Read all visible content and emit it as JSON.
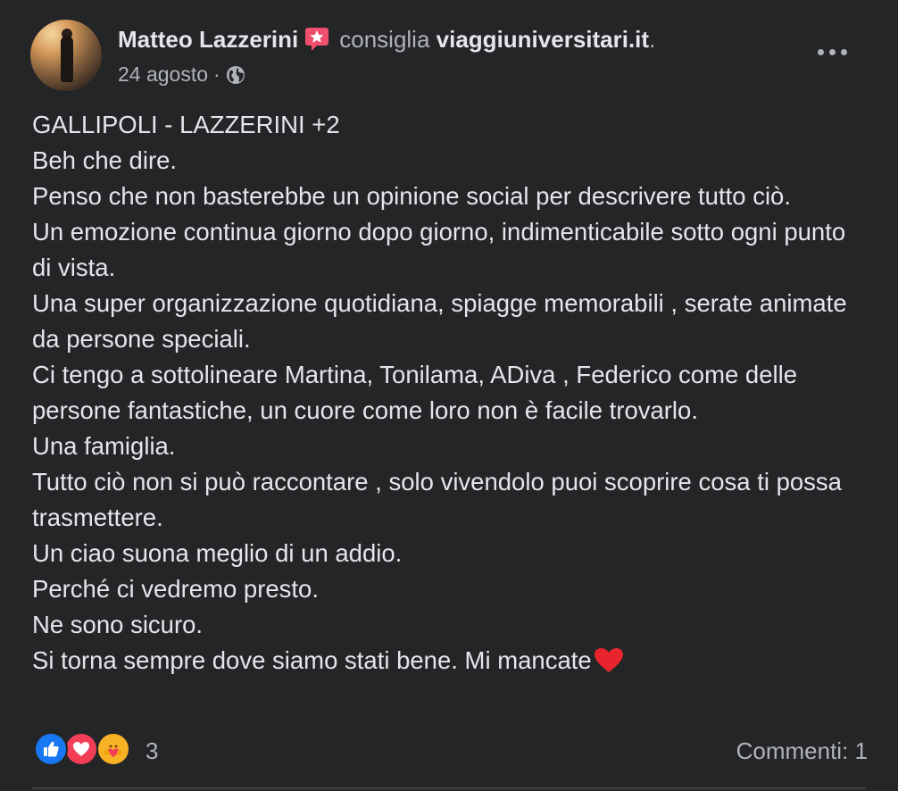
{
  "post": {
    "author": "Matteo Lazzerini",
    "action": "consiglia",
    "page": "viaggiuniversitari.it",
    "page_suffix": ".",
    "date": "24 agosto",
    "privacy_icon": "globe-icon",
    "badge_icon": "recommendation-star-icon",
    "more_icon": "more-options-icon",
    "paragraphs": [
      "GALLIPOLI - LAZZERINI +2",
      "Beh che dire.",
      "Penso che non basterebbe un opinione social per descrivere tutto ciò.",
      "Un emozione continua giorno dopo giorno, indimenticabile sotto ogni punto di vista.",
      "Una super organizzazione quotidiana, spiagge memorabili , serate animate da persone speciali.",
      "Ci tengo a sottolineare Martina, Tonilama, ADiva , Federico come delle persone fantastiche, un cuore come loro non è facile trovarlo.",
      "Una famiglia.",
      "Tutto ciò non si può raccontare , solo vivendolo puoi scoprire cosa ti possa trasmettere.",
      "Un ciao suona meglio di un addio.",
      "Perché ci vedremo presto.",
      "Ne sono sicuro."
    ],
    "last_line": "Si torna sempre dove siamo stati bene. Mi mancate",
    "last_line_emoji": "red-heart-emoji",
    "reactions": {
      "types": [
        "like-reaction-icon",
        "love-reaction-icon",
        "care-reaction-icon"
      ],
      "count": "3"
    },
    "comments_label": "Commenti: 1"
  },
  "colors": {
    "background": "#242526",
    "text_primary": "#e4e6eb",
    "text_secondary": "#b0b3b8",
    "like_blue": "#1877f2",
    "love_red": "#f33e58",
    "care_yellow": "#f7b125",
    "badge_pink": "#f0506e"
  }
}
